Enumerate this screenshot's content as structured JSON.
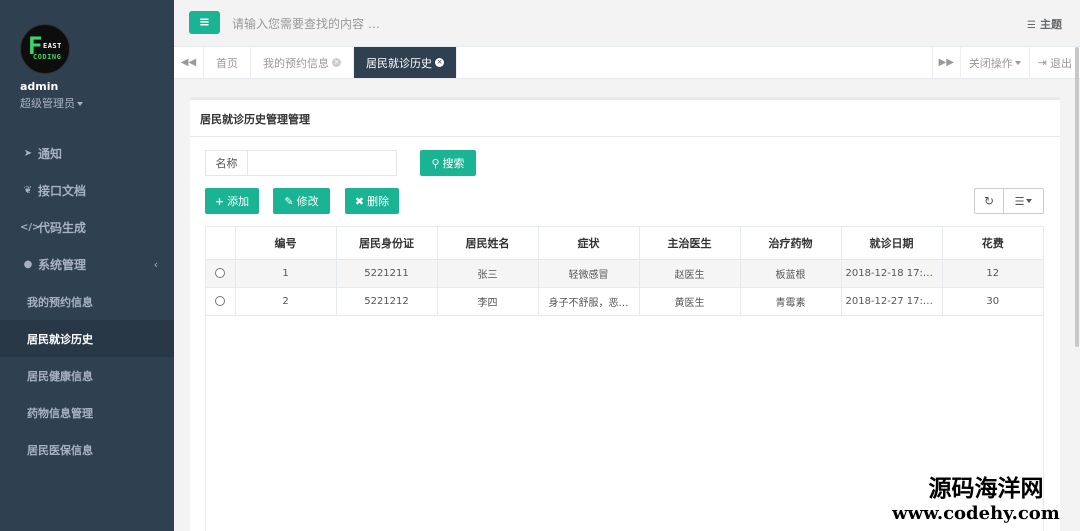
{
  "sidebar": {
    "logo": {
      "mark": "F",
      "line1": "EAST",
      "line2": "CODING"
    },
    "username": "admin",
    "role": "超级管理员",
    "menu": [
      {
        "label": "通知",
        "icon": "paper-plane-icon",
        "glyph": "➤"
      },
      {
        "label": "接口文档",
        "icon": "leaf-icon",
        "glyph": "❦"
      },
      {
        "label": "代码生成",
        "icon": "code-icon",
        "glyph": "</>"
      },
      {
        "label": "系统管理",
        "icon": "user-icon",
        "glyph": "●",
        "chevron": "‹"
      }
    ],
    "submenu": [
      {
        "label": "我的预约信息",
        "active": false
      },
      {
        "label": "居民就诊历史",
        "active": true
      },
      {
        "label": "居民健康信息",
        "active": false
      },
      {
        "label": "药物信息管理",
        "active": false
      },
      {
        "label": "居民医保信息",
        "active": false
      }
    ]
  },
  "topbar": {
    "menu_glyph": "≡",
    "search_placeholder": "请输入您需要查找的内容 …",
    "theme_label": "主题",
    "theme_glyph": "☰"
  },
  "tabbar": {
    "back_glyph": "◀◀",
    "tabs": [
      {
        "label": "首页",
        "closable": false,
        "active": false
      },
      {
        "label": "我的预约信息",
        "closable": true,
        "active": false
      },
      {
        "label": "居民就诊历史",
        "closable": true,
        "active": true
      }
    ],
    "forward_glyph": "▶▶",
    "close_ops_label": "关闭操作",
    "logout_label": "退出",
    "logout_glyph": "⇥"
  },
  "panel": {
    "title": "居民就诊历史管理管理",
    "search_label": "名称",
    "search_value": "",
    "search_button": "搜索",
    "search_glyph": "⚲",
    "add_button": "添加",
    "add_glyph": "+",
    "edit_button": "修改",
    "edit_glyph": "✎",
    "delete_button": "删除",
    "delete_glyph": "✖",
    "refresh_glyph": "↻",
    "columns_glyph": "☰"
  },
  "table": {
    "headers": [
      "",
      "编号",
      "居民身份证",
      "居民姓名",
      "症状",
      "主治医生",
      "治疗药物",
      "就诊日期",
      "花费"
    ],
    "rows": [
      [
        "",
        "1",
        "5221211",
        "张三",
        "轻微感冒",
        "赵医生",
        "板蓝根",
        "2018-12-18 17:1…",
        "12"
      ],
      [
        "",
        "2",
        "5221212",
        "李四",
        "身子不舒服，恶…",
        "黄医生",
        "青霉素",
        "2018-12-27 17:1…",
        "30"
      ]
    ]
  },
  "watermark": {
    "line1": "源码海洋网",
    "line2": "www.codehy.com"
  },
  "colors": {
    "accent": "#1ab394",
    "sidebar_bg": "#2f4050",
    "sidebar_active": "#293846"
  }
}
